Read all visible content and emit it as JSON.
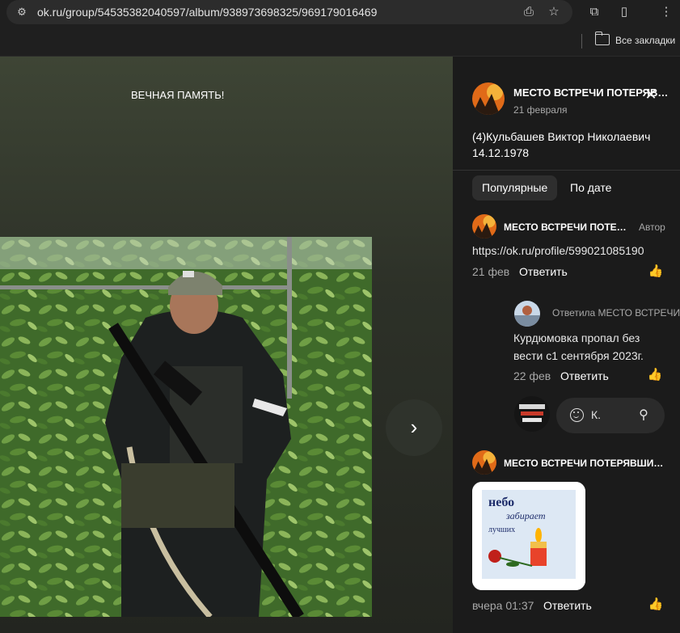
{
  "browser": {
    "url": "ok.ru/group/54535382040597/album/938973698325/969179016469",
    "bookmarks_label": "Все закладки"
  },
  "viewer": {
    "caption": "ВЕЧНАЯ ПАМЯТЬ!"
  },
  "panel": {
    "group_name": "МЕСТО ВСТРЕЧИ ПОТЕРЯВШИЕСЯ",
    "date": "21 февраля",
    "post_text": "(4)Кульбашев Виктор Николаевич 14.12.1978",
    "tabs": [
      "Популярные",
      "По дате"
    ],
    "comments": [
      {
        "author": "МЕСТО ВСТРЕЧИ ПОТЕРЯВШИЕСЯ",
        "badge": "Автор",
        "text": "https://ok.ru/profile/599021085190",
        "time": "21 фев",
        "reply": "Ответить"
      },
      {
        "reply_to": "Ответила МЕСТО ВСТРЕЧИ",
        "text": "Курдюмовка пропал без вести с1 сентября 2023г.",
        "time": "22 фев",
        "reply": "Ответить"
      },
      {
        "author": "МЕСТО ВСТРЕЧИ ПОТЕРЯВШИЕСЯ",
        "image_text": [
          "небо",
          "забирает",
          "лучших"
        ],
        "time": "вчера 01:37",
        "reply": "Ответить"
      }
    ],
    "composer": {
      "text": "К."
    }
  },
  "colors": {
    "panel_bg": "#1b1b1b",
    "viewer_bg": "#2d3128"
  }
}
